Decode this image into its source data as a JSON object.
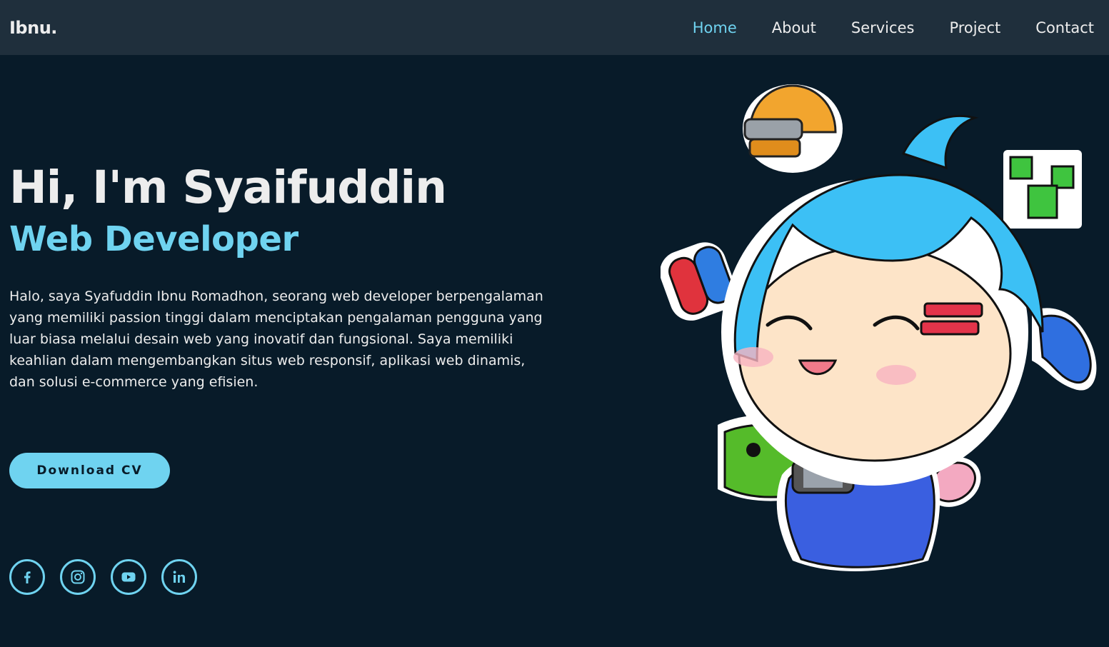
{
  "header": {
    "logo": "Ibnu.",
    "nav": [
      {
        "label": "Home",
        "active": true
      },
      {
        "label": "About",
        "active": false
      },
      {
        "label": "Services",
        "active": false
      },
      {
        "label": "Project",
        "active": false
      },
      {
        "label": "Contact",
        "active": false
      }
    ]
  },
  "hero": {
    "title": "Hi, I'm Syaifuddin",
    "role": "Web Developer",
    "description": "Halo, saya Syafuddin Ibnu Romadhon, seorang web developer berpengalaman yang memiliki passion tinggi dalam menciptakan pengalaman pengguna yang luar biasa melalui desain web yang inovatif dan fungsional. Saya memiliki keahlian dalam mengembangkan situs web responsif, aplikasi web dinamis, dan solusi e-commerce yang efisien.",
    "cta_label": "Download CV"
  },
  "socials": [
    {
      "icon": "facebook-icon"
    },
    {
      "icon": "instagram-icon"
    },
    {
      "icon": "youtube-icon"
    },
    {
      "icon": "linkedin-icon"
    }
  ],
  "colors": {
    "background": "#081b29",
    "navbar": "#1f2f3c",
    "accent": "#6fd3f0",
    "text": "#ededed"
  }
}
